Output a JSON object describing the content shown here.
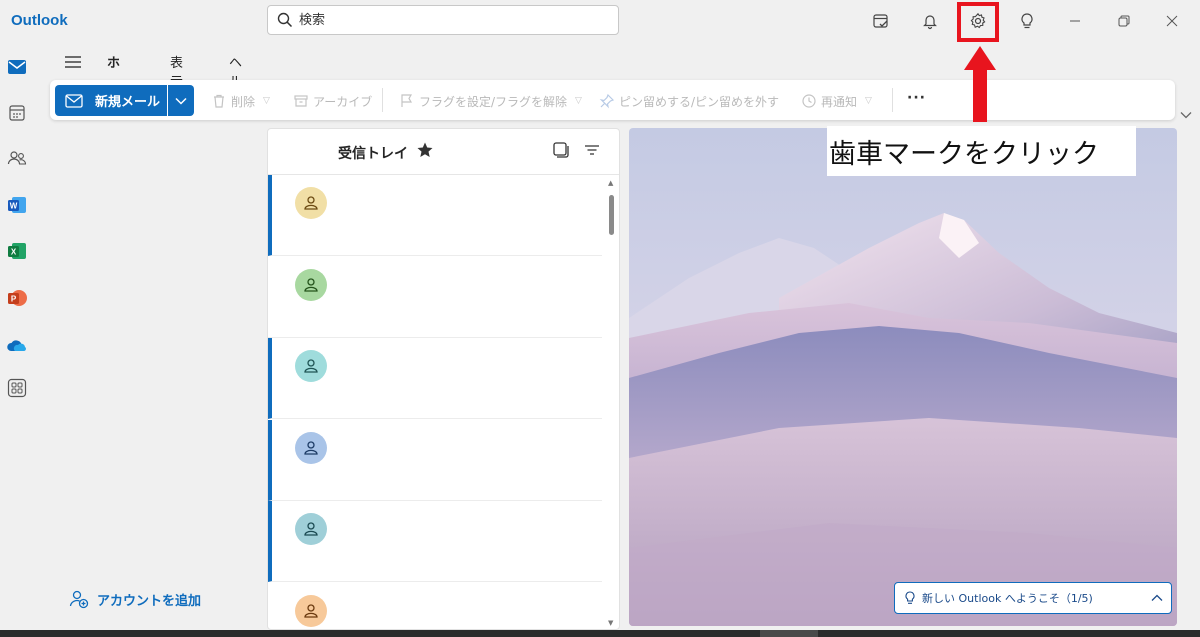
{
  "app": {
    "title": "Outlook"
  },
  "search": {
    "placeholder": "検索"
  },
  "ribbon": {
    "tabs": [
      {
        "label": "ホーム",
        "active": true
      },
      {
        "label": "表示",
        "active": false
      },
      {
        "label": "ヘルプ",
        "active": false
      }
    ]
  },
  "toolbar": {
    "new_mail": "新規メール",
    "delete": "削除",
    "archive": "アーカイブ",
    "flag": "フラグを設定/フラグを解除",
    "pin": "ピン留めする/ピン留めを外す",
    "snooze": "再通知",
    "more": "···"
  },
  "folder_pane": {
    "add_account": "アカウントを追加"
  },
  "message_list": {
    "title": "受信トレイ",
    "items": [
      {
        "avatar_color": "#f1dfa6",
        "unread": true
      },
      {
        "avatar_color": "#a8d8a0",
        "unread": false
      },
      {
        "avatar_color": "#9fdcdc",
        "unread": true
      },
      {
        "avatar_color": "#a9c4e8",
        "unread": true
      },
      {
        "avatar_color": "#9fcfd8",
        "unread": true
      },
      {
        "avatar_color": "#f7c99a",
        "unread": false
      }
    ]
  },
  "annotation": {
    "text": "歯車マークをクリック",
    "highlight_color": "#e8141e"
  },
  "welcome": {
    "text": "新しい Outlook へようこそ（1/5)"
  },
  "colors": {
    "accent": "#0f6cbd",
    "highlight": "#e8141e"
  }
}
